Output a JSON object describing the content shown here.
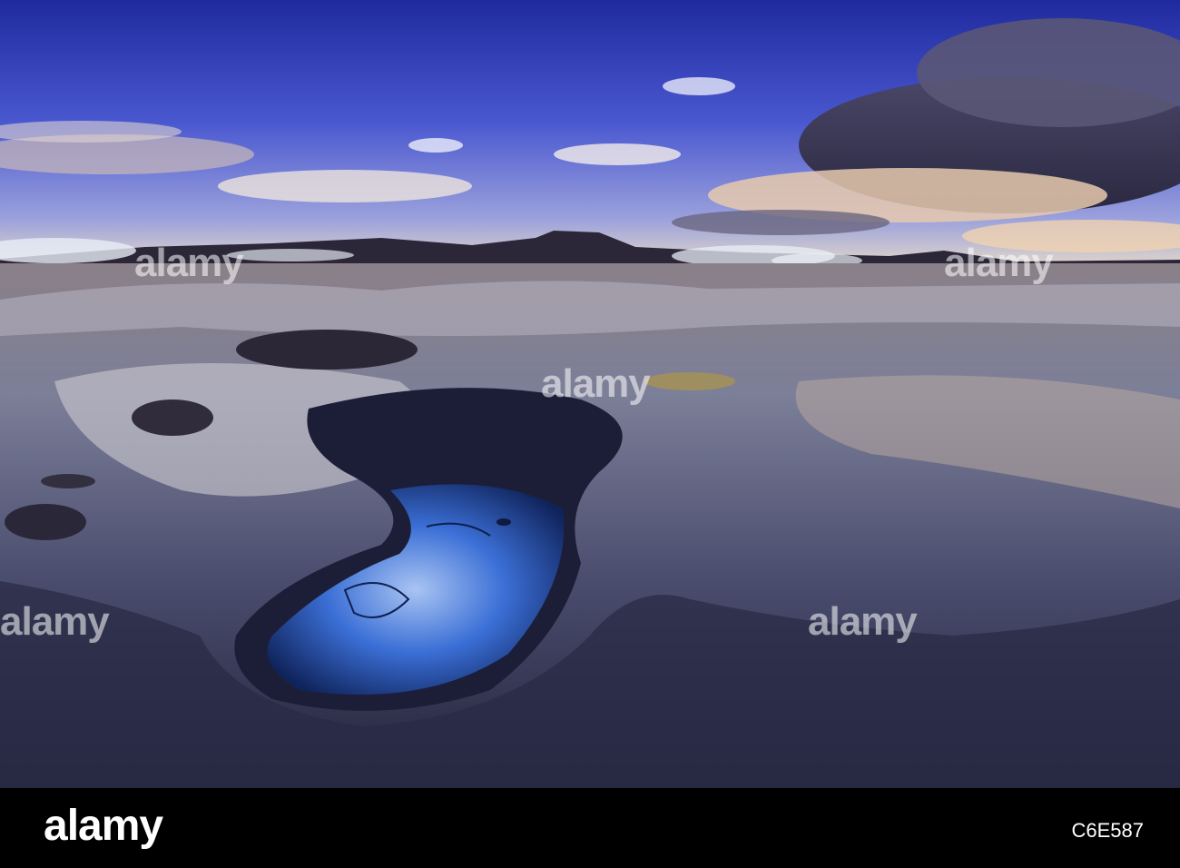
{
  "watermark": {
    "text": "alamy",
    "dot_glyph": "a"
  },
  "footer": {
    "logo": "alamy",
    "image_code": "C6E587"
  },
  "colors": {
    "sky_top": "#2430a8",
    "sky_mid": "#5b66d8",
    "horizon": "#e8dccb",
    "mud_pool": "#1d4fb8",
    "ground": "#6e6e86",
    "footer_bg": "#000000"
  }
}
